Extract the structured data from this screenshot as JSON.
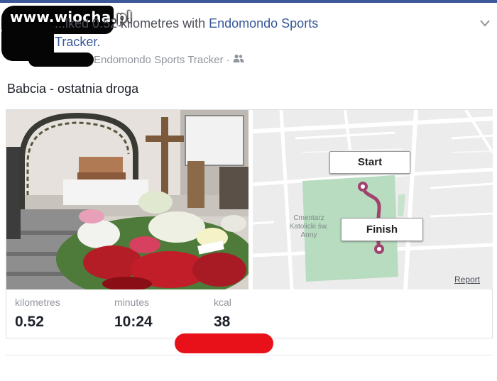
{
  "watermark": "www.wiocha.pl",
  "header": {
    "action_prefix": "...lked 0.52 kilometres with ",
    "app_link": "Endomondo Sports",
    "app_link_line2": "Tracker.",
    "source": "Endomondo Sports Tracker",
    "separator": "·",
    "audience_icon": "friends-icon"
  },
  "post": {
    "text": "Babcia - ostatnia droga"
  },
  "map": {
    "start_label": "Start",
    "finish_label": "Finish",
    "cemetery_label": [
      "Cmentarz",
      "Katolicki św.",
      "Anny"
    ],
    "report_link": "Report"
  },
  "stats": [
    {
      "label": "kilometres",
      "value": "0.52"
    },
    {
      "label": "minutes",
      "value": "10:24"
    },
    {
      "label": "kcal",
      "value": "38"
    }
  ],
  "colors": {
    "brand": "#3b5998",
    "link": "#365899",
    "route": "#a2426e",
    "redaction": "#050505",
    "marker_red": "#e8111a",
    "cemetery_green": "#b7dcc0"
  }
}
